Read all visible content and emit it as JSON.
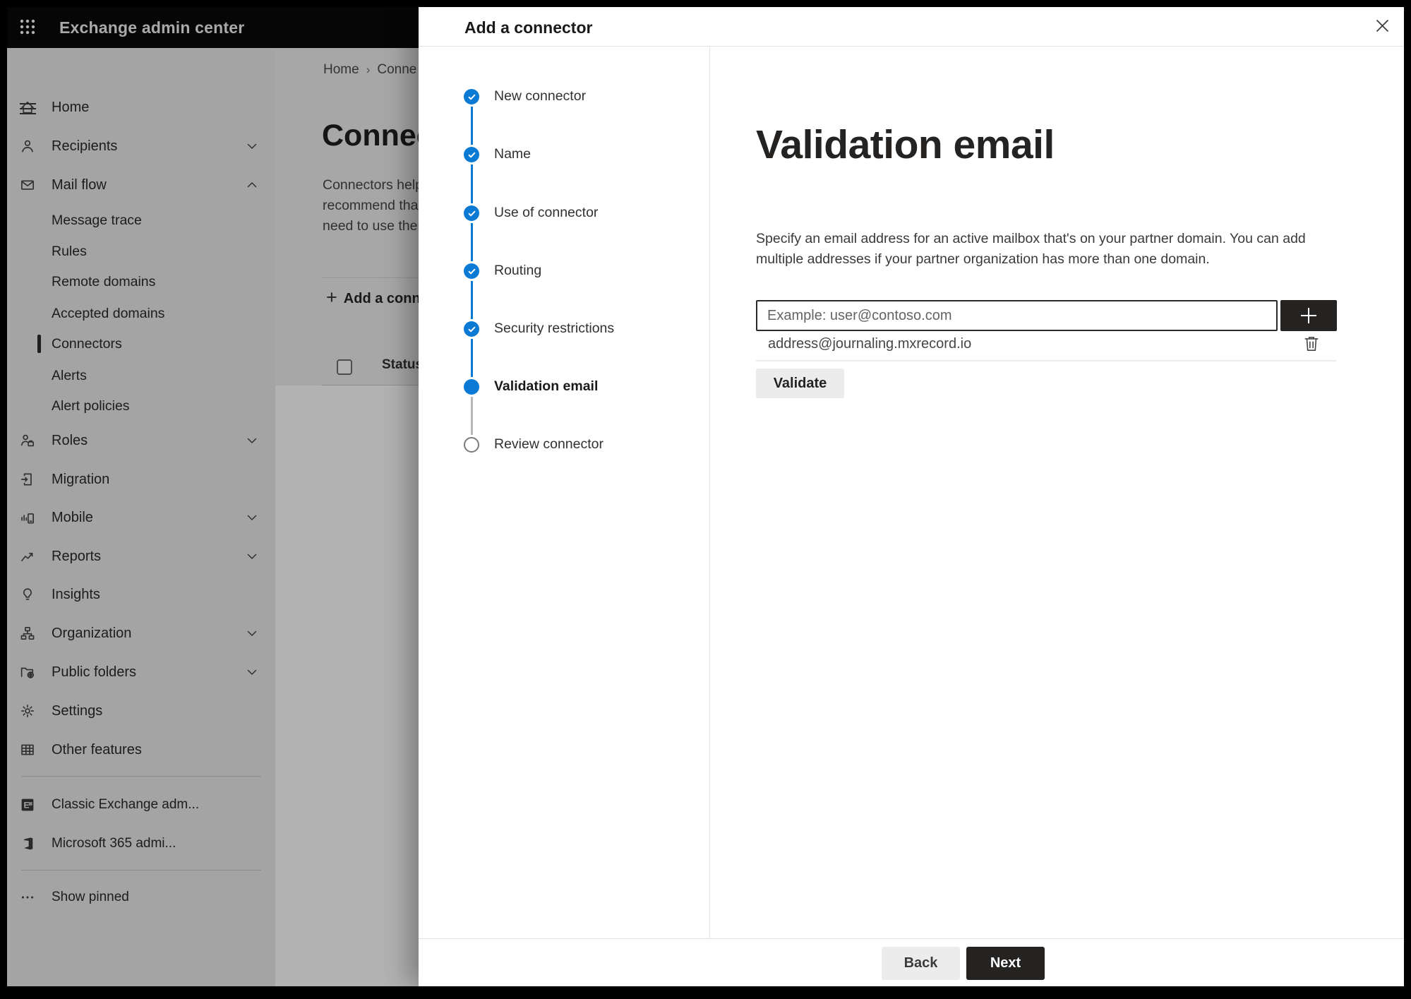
{
  "topbar": {
    "app_title": "Exchange admin center"
  },
  "sidebar": {
    "items": [
      {
        "label": "Home",
        "icon": "home-icon",
        "expandable": false
      },
      {
        "label": "Recipients",
        "icon": "person-icon",
        "expandable": true,
        "expanded": false
      },
      {
        "label": "Mail flow",
        "icon": "mail-icon",
        "expandable": true,
        "expanded": true,
        "children": [
          "Message trace",
          "Rules",
          "Remote domains",
          "Accepted domains",
          "Connectors",
          "Alerts",
          "Alert policies"
        ],
        "selected_child": "Connectors"
      },
      {
        "label": "Roles",
        "icon": "roles-icon",
        "expandable": true,
        "expanded": false
      },
      {
        "label": "Migration",
        "icon": "migration-icon",
        "expandable": false
      },
      {
        "label": "Mobile",
        "icon": "mobile-icon",
        "expandable": true,
        "expanded": false
      },
      {
        "label": "Reports",
        "icon": "reports-icon",
        "expandable": true,
        "expanded": false
      },
      {
        "label": "Insights",
        "icon": "insights-icon",
        "expandable": false
      },
      {
        "label": "Organization",
        "icon": "organization-icon",
        "expandable": true,
        "expanded": false
      },
      {
        "label": "Public folders",
        "icon": "public-folders-icon",
        "expandable": true,
        "expanded": false
      },
      {
        "label": "Settings",
        "icon": "gear-icon",
        "expandable": false
      },
      {
        "label": "Other features",
        "icon": "table-grid-icon",
        "expandable": false
      }
    ],
    "footer_items": [
      {
        "label": "Classic Exchange adm...",
        "icon": "classic-exchange-icon"
      },
      {
        "label": "Microsoft 365 admi...",
        "icon": "microsoft-365-icon"
      }
    ],
    "show_pinned": {
      "label": "Show pinned",
      "icon": "ellipsis-icon"
    }
  },
  "page": {
    "breadcrumb": {
      "home": "Home",
      "current": "Conne"
    },
    "title": "Connect",
    "description_lines": [
      "Connectors help",
      "recommend that",
      "need to use ther"
    ],
    "add_button_label": "Add a conn",
    "table_header_status": "Status"
  },
  "dialog": {
    "title": "Add a connector",
    "steps": [
      {
        "label": "New connector",
        "state": "completed"
      },
      {
        "label": "Name",
        "state": "completed"
      },
      {
        "label": "Use of connector",
        "state": "completed"
      },
      {
        "label": "Routing",
        "state": "completed"
      },
      {
        "label": "Security restrictions",
        "state": "completed"
      },
      {
        "label": "Validation email",
        "state": "current"
      },
      {
        "label": "Review connector",
        "state": "upcoming"
      }
    ],
    "heading": "Validation email",
    "description": "Specify an email address for an active mailbox that's on your partner domain. You can add multiple addresses if your partner organization has more than one domain.",
    "email_input": {
      "value": "",
      "placeholder": "Example: user@contoso.com"
    },
    "addresses": [
      "address@journaling.mxrecord.io"
    ],
    "validate_button": "Validate",
    "back_button": "Back",
    "next_button": "Next"
  },
  "colors": {
    "accent": "#0b7ad4",
    "topbar_bg": "#0b0a0a",
    "dark_button_bg": "#242322",
    "overlay": "rgba(0,0,0,0.30)"
  }
}
